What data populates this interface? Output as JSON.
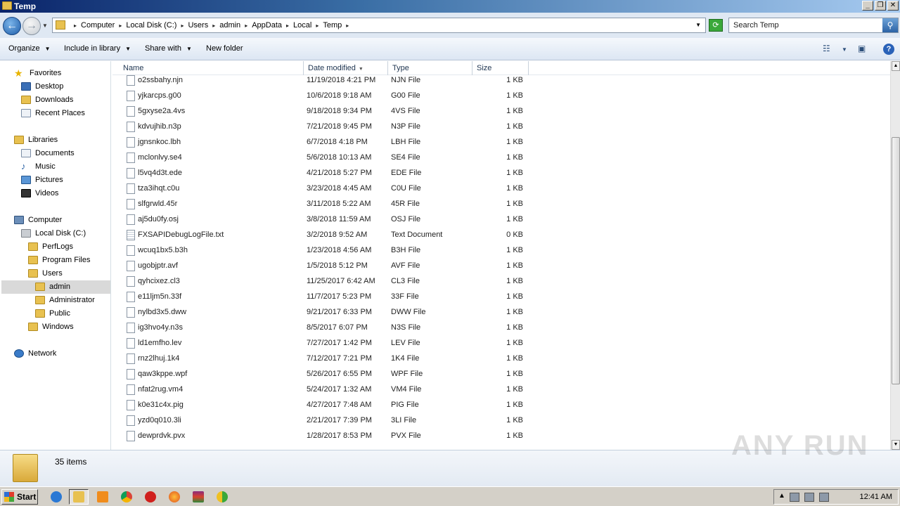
{
  "window": {
    "title": "Temp"
  },
  "address": {
    "breadcrumbs": [
      "Computer",
      "Local Disk (C:)",
      "Users",
      "admin",
      "AppData",
      "Local",
      "Temp"
    ],
    "search_placeholder": "Search Temp"
  },
  "toolbar": {
    "organize": "Organize",
    "include": "Include in library",
    "share": "Share with",
    "new_folder": "New folder"
  },
  "nav": {
    "favorites": "Favorites",
    "desktop": "Desktop",
    "downloads": "Downloads",
    "recent": "Recent Places",
    "libraries": "Libraries",
    "documents": "Documents",
    "music": "Music",
    "pictures": "Pictures",
    "videos": "Videos",
    "computer": "Computer",
    "local_disk": "Local Disk (C:)",
    "perflogs": "PerfLogs",
    "program_files": "Program Files",
    "users": "Users",
    "admin": "admin",
    "administrator": "Administrator",
    "public": "Public",
    "windows": "Windows",
    "network": "Network"
  },
  "columns": {
    "name": "Name",
    "date": "Date modified",
    "type": "Type",
    "size": "Size"
  },
  "files": [
    {
      "name": "o2ssbahy.njn",
      "date": "11/19/2018 4:21 PM",
      "type": "NJN File",
      "size": "1 KB"
    },
    {
      "name": "yjkarcps.g00",
      "date": "10/6/2018 9:18 AM",
      "type": "G00 File",
      "size": "1 KB"
    },
    {
      "name": "5gxyse2a.4vs",
      "date": "9/18/2018 9:34 PM",
      "type": "4VS File",
      "size": "1 KB"
    },
    {
      "name": "kdvujhib.n3p",
      "date": "7/21/2018 9:45 PM",
      "type": "N3P File",
      "size": "1 KB"
    },
    {
      "name": "jgnsnkoc.lbh",
      "date": "6/7/2018 4:18 PM",
      "type": "LBH File",
      "size": "1 KB"
    },
    {
      "name": "mclonlvy.se4",
      "date": "5/6/2018 10:13 AM",
      "type": "SE4 File",
      "size": "1 KB"
    },
    {
      "name": "l5vq4d3t.ede",
      "date": "4/21/2018 5:27 PM",
      "type": "EDE File",
      "size": "1 KB"
    },
    {
      "name": "tza3ihqt.c0u",
      "date": "3/23/2018 4:45 AM",
      "type": "C0U File",
      "size": "1 KB"
    },
    {
      "name": "slfgrwld.45r",
      "date": "3/11/2018 5:22 AM",
      "type": "45R File",
      "size": "1 KB"
    },
    {
      "name": "aj5du0fy.osj",
      "date": "3/8/2018 11:59 AM",
      "type": "OSJ File",
      "size": "1 KB"
    },
    {
      "name": "FXSAPIDebugLogFile.txt",
      "date": "3/2/2018 9:52 AM",
      "type": "Text Document",
      "size": "0 KB",
      "txt": true
    },
    {
      "name": "wcuq1bx5.b3h",
      "date": "1/23/2018 4:56 AM",
      "type": "B3H File",
      "size": "1 KB"
    },
    {
      "name": "ugobjptr.avf",
      "date": "1/5/2018 5:12 PM",
      "type": "AVF File",
      "size": "1 KB"
    },
    {
      "name": "qyhcixez.cl3",
      "date": "11/25/2017 6:42 AM",
      "type": "CL3 File",
      "size": "1 KB"
    },
    {
      "name": "e11ljm5n.33f",
      "date": "11/7/2017 5:23 PM",
      "type": "33F File",
      "size": "1 KB"
    },
    {
      "name": "nylbd3x5.dww",
      "date": "9/21/2017 6:33 PM",
      "type": "DWW File",
      "size": "1 KB"
    },
    {
      "name": "ig3hvo4y.n3s",
      "date": "8/5/2017 6:07 PM",
      "type": "N3S File",
      "size": "1 KB"
    },
    {
      "name": "ld1emfho.lev",
      "date": "7/27/2017 1:42 PM",
      "type": "LEV File",
      "size": "1 KB"
    },
    {
      "name": "rnz2lhuj.1k4",
      "date": "7/12/2017 7:21 PM",
      "type": "1K4 File",
      "size": "1 KB"
    },
    {
      "name": "qaw3kppe.wpf",
      "date": "5/26/2017 6:55 PM",
      "type": "WPF File",
      "size": "1 KB"
    },
    {
      "name": "nfat2rug.vm4",
      "date": "5/24/2017 1:32 AM",
      "type": "VM4 File",
      "size": "1 KB"
    },
    {
      "name": "k0e31c4x.pig",
      "date": "4/27/2017 7:48 AM",
      "type": "PIG File",
      "size": "1 KB"
    },
    {
      "name": "yzd0q010.3li",
      "date": "2/21/2017 7:39 PM",
      "type": "3LI File",
      "size": "1 KB"
    },
    {
      "name": "dewprdvk.pvx",
      "date": "1/28/2017 8:53 PM",
      "type": "PVX File",
      "size": "1 KB"
    }
  ],
  "status": {
    "items": "35 items"
  },
  "watermark": "ANY RUN",
  "taskbar": {
    "start": "Start",
    "clock": "12:41 AM"
  }
}
